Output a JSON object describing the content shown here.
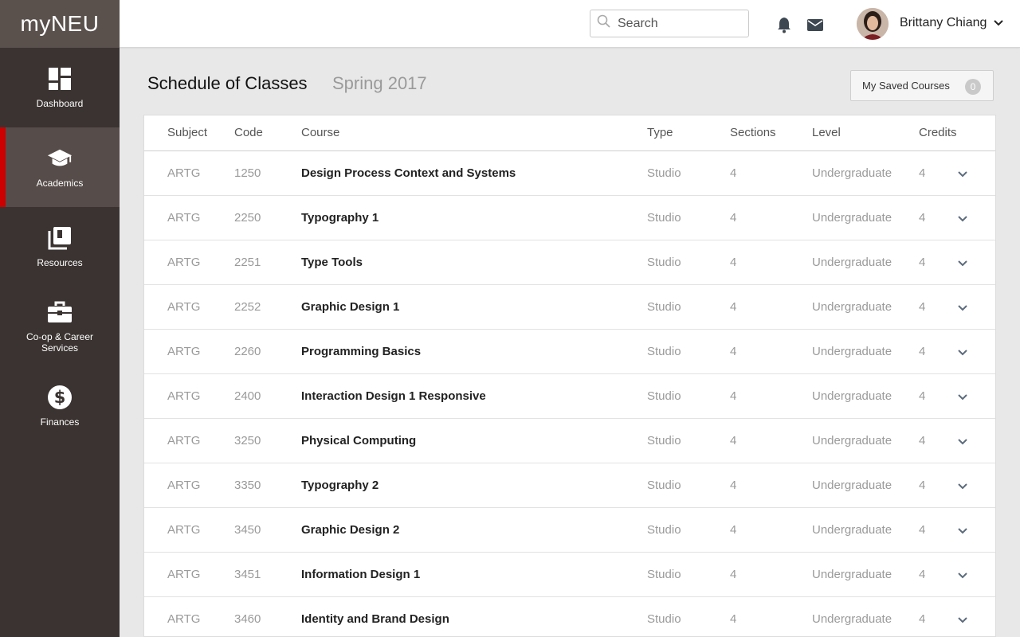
{
  "app": {
    "logo": "myNEU"
  },
  "sidebar": {
    "items": [
      {
        "label": "Dashboard",
        "icon": "dashboard-icon"
      },
      {
        "label": "Academics",
        "icon": "graduation-cap-icon",
        "active": true
      },
      {
        "label": "Resources",
        "icon": "books-icon"
      },
      {
        "label": "Co-op & Career Services",
        "icon": "briefcase-icon"
      },
      {
        "label": "Finances",
        "icon": "dollar-icon"
      }
    ]
  },
  "header": {
    "search_placeholder": "Search",
    "user_name": "Brittany Chiang"
  },
  "page": {
    "title": "Schedule of Classes",
    "term": "Spring 2017",
    "saved_courses_label": "My Saved Courses",
    "saved_courses_count": "0"
  },
  "table": {
    "headers": [
      "Subject",
      "Code",
      "Course",
      "Type",
      "Sections",
      "Level",
      "Credits"
    ],
    "rows": [
      {
        "subject": "ARTG",
        "code": "1250",
        "course": "Design Process Context and Systems",
        "type": "Studio",
        "sections": "4",
        "level": "Undergraduate",
        "credits": "4"
      },
      {
        "subject": "ARTG",
        "code": "2250",
        "course": "Typography 1",
        "type": "Studio",
        "sections": "4",
        "level": "Undergraduate",
        "credits": "4"
      },
      {
        "subject": "ARTG",
        "code": "2251",
        "course": "Type Tools",
        "type": "Studio",
        "sections": "4",
        "level": "Undergraduate",
        "credits": "4"
      },
      {
        "subject": "ARTG",
        "code": "2252",
        "course": "Graphic Design 1",
        "type": "Studio",
        "sections": "4",
        "level": "Undergraduate",
        "credits": "4"
      },
      {
        "subject": "ARTG",
        "code": "2260",
        "course": "Programming Basics",
        "type": "Studio",
        "sections": "4",
        "level": "Undergraduate",
        "credits": "4"
      },
      {
        "subject": "ARTG",
        "code": "2400",
        "course": "Interaction Design 1 Responsive",
        "type": "Studio",
        "sections": "4",
        "level": "Undergraduate",
        "credits": "4"
      },
      {
        "subject": "ARTG",
        "code": "3250",
        "course": "Physical Computing",
        "type": "Studio",
        "sections": "4",
        "level": "Undergraduate",
        "credits": "4"
      },
      {
        "subject": "ARTG",
        "code": "3350",
        "course": "Typography 2",
        "type": "Studio",
        "sections": "4",
        "level": "Undergraduate",
        "credits": "4"
      },
      {
        "subject": "ARTG",
        "code": "3450",
        "course": "Graphic Design 2",
        "type": "Studio",
        "sections": "4",
        "level": "Undergraduate",
        "credits": "4"
      },
      {
        "subject": "ARTG",
        "code": "3451",
        "course": "Information Design 1",
        "type": "Studio",
        "sections": "4",
        "level": "Undergraduate",
        "credits": "4"
      },
      {
        "subject": "ARTG",
        "code": "3460",
        "course": "Identity and Brand Design",
        "type": "Studio",
        "sections": "4",
        "level": "Undergraduate",
        "credits": "4"
      }
    ]
  },
  "colors": {
    "sidebar": "#3a3331",
    "active_accent": "#cc0000",
    "muted_text": "#9a9a9a"
  }
}
